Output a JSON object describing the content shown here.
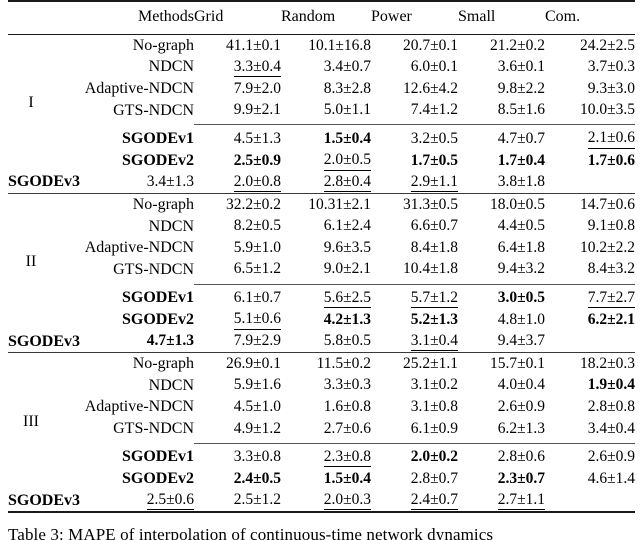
{
  "table": {
    "columns": [
      "Methods",
      "Grid",
      "Random",
      "Power",
      "Small",
      "Com."
    ],
    "groups": [
      {
        "label": "I",
        "baseline_rows": [
          {
            "method": "No-graph",
            "values": [
              "41.1±0.1",
              "10.1±16.8",
              "20.7±0.1",
              "21.2±0.2",
              "24.2±2.5"
            ],
            "styles": [
              "",
              "",
              "",
              "",
              ""
            ]
          },
          {
            "method": "NDCN",
            "values": [
              "3.3±0.4",
              "3.4±0.7",
              "6.0±0.1",
              "3.6±0.1",
              "3.7±0.3"
            ],
            "styles": [
              "u",
              "",
              "",
              "",
              ""
            ]
          },
          {
            "method": "Adaptive-NDCN",
            "values": [
              "7.9±2.0",
              "8.3±2.8",
              "12.6±4.2",
              "9.8±2.2",
              "9.3±3.0"
            ],
            "styles": [
              "",
              "",
              "",
              "",
              ""
            ]
          },
          {
            "method": "GTS-NDCN",
            "values": [
              "9.9±2.1",
              "5.0±1.1",
              "7.4±1.2",
              "8.5±1.6",
              "10.0±3.5"
            ],
            "styles": [
              "",
              "",
              "",
              "",
              ""
            ]
          }
        ],
        "proposed_rows": [
          {
            "method": "SGODEv1",
            "values": [
              "4.5±1.3",
              "1.5±0.4",
              "3.2±0.5",
              "4.7±0.7",
              "2.1±0.6"
            ],
            "styles": [
              "",
              "b",
              "",
              "",
              "u"
            ]
          },
          {
            "method": "SGODEv2",
            "values": [
              "2.5±0.9",
              "2.0±0.5",
              "1.7±0.5",
              "1.7±0.4",
              "1.7±0.6"
            ],
            "styles": [
              "b",
              "u",
              "b",
              "b",
              "b"
            ]
          },
          {
            "method": "SGODEv3",
            "values": [
              "3.4±1.3",
              "2.0±0.8",
              "2.8±0.4",
              "2.9±1.1",
              "3.8±1.8"
            ],
            "styles": [
              "",
              "u",
              "u",
              "u",
              ""
            ]
          }
        ]
      },
      {
        "label": "II",
        "baseline_rows": [
          {
            "method": "No-graph",
            "values": [
              "32.2±0.2",
              "10.31±2.1",
              "31.3±0.5",
              "18.0±0.5",
              "14.7±0.6"
            ],
            "styles": [
              "",
              "",
              "",
              "",
              ""
            ]
          },
          {
            "method": "NDCN",
            "values": [
              "8.2±0.5",
              "6.1±2.4",
              "6.6±0.7",
              "4.4±0.5",
              "9.1±0.8"
            ],
            "styles": [
              "",
              "",
              "",
              "",
              ""
            ]
          },
          {
            "method": "Adaptive-NDCN",
            "values": [
              "5.9±1.0",
              "9.6±3.5",
              "8.4±1.8",
              "6.4±1.8",
              "10.2±2.2"
            ],
            "styles": [
              "",
              "",
              "",
              "",
              ""
            ]
          },
          {
            "method": "GTS-NDCN",
            "values": [
              "6.5±1.2",
              "9.0±2.1",
              "10.4±1.8",
              "9.4±3.2",
              "8.4±3.2"
            ],
            "styles": [
              "",
              "",
              "",
              "",
              ""
            ]
          }
        ],
        "proposed_rows": [
          {
            "method": "SGODEv1",
            "values": [
              "6.1±0.7",
              "5.6±2.5",
              "5.7±1.2",
              "3.0±0.5",
              "7.7±2.7"
            ],
            "styles": [
              "",
              "u",
              "u",
              "b",
              "u"
            ]
          },
          {
            "method": "SGODEv2",
            "values": [
              "5.1±0.6",
              "4.2±1.3",
              "5.2±1.3",
              "4.8±1.0",
              "6.2±2.1"
            ],
            "styles": [
              "u",
              "b",
              "b",
              "",
              "b"
            ]
          },
          {
            "method": "SGODEv3",
            "values": [
              "4.7±1.3",
              "7.9±2.9",
              "5.8±0.5",
              "3.1±0.4",
              "9.4±3.7"
            ],
            "styles": [
              "b",
              "",
              "",
              "u",
              ""
            ]
          }
        ]
      },
      {
        "label": "III",
        "baseline_rows": [
          {
            "method": "No-graph",
            "values": [
              "26.9±0.1",
              "11.5±0.2",
              "25.2±1.1",
              "15.7±0.1",
              "18.2±0.3"
            ],
            "styles": [
              "",
              "",
              "",
              "",
              ""
            ]
          },
          {
            "method": "NDCN",
            "values": [
              "5.9±1.6",
              "3.3±0.3",
              "3.1±0.2",
              "4.0±0.4",
              "1.9±0.4"
            ],
            "styles": [
              "",
              "",
              "",
              "",
              "b"
            ]
          },
          {
            "method": "Adaptive-NDCN",
            "values": [
              "4.5±1.0",
              "1.6±0.8",
              "3.1±0.8",
              "2.6±0.9",
              "2.8±0.8"
            ],
            "styles": [
              "",
              "",
              "",
              "",
              ""
            ]
          },
          {
            "method": "GTS-NDCN",
            "values": [
              "4.9±1.2",
              "2.7±0.6",
              "6.1±0.9",
              "6.2±1.3",
              "3.4±0.4"
            ],
            "styles": [
              "",
              "",
              "",
              "",
              ""
            ]
          }
        ],
        "proposed_rows": [
          {
            "method": "SGODEv1",
            "values": [
              "3.3±0.8",
              "2.3±0.8",
              "2.0±0.2",
              "2.8±0.6",
              "2.6±0.9"
            ],
            "styles": [
              "",
              "u",
              "b",
              "",
              ""
            ]
          },
          {
            "method": "SGODEv2",
            "values": [
              "2.4±0.5",
              "1.5±0.4",
              "2.8±0.7",
              "2.3±0.7",
              "4.6±1.4"
            ],
            "styles": [
              "b",
              "b",
              "",
              "b",
              ""
            ]
          },
          {
            "method": "SGODEv3",
            "values": [
              "2.5±0.6",
              "2.5±1.2",
              "2.0±0.3",
              "2.4±0.7",
              "2.7±1.1"
            ],
            "styles": [
              "u",
              "",
              "u",
              "u",
              "u"
            ]
          }
        ]
      }
    ]
  },
  "caption": {
    "text": "Table 3: MAPE of interpolation of continuous-time network dynamics"
  }
}
